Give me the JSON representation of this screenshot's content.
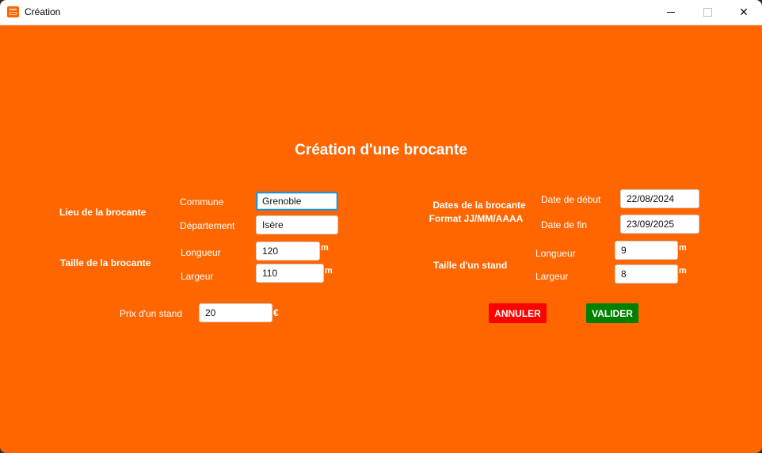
{
  "window": {
    "title": "Création"
  },
  "form": {
    "heading": "Création d'une brocante",
    "lieu": {
      "label": "Lieu de la brocante",
      "commune_label": "Commune",
      "commune_value": "Grenoble",
      "departement_label": "Département",
      "departement_value": "Isère"
    },
    "taille_brocante": {
      "label": "Taille de la brocante",
      "longueur_label": "Longueur",
      "longueur_value": "120",
      "largeur_label": "Largeur",
      "largeur_value": "110",
      "unit": "m"
    },
    "prix": {
      "label": "Prix d'un stand",
      "value": "20",
      "unit": "€"
    },
    "dates": {
      "label_line1": "Dates de la brocante",
      "label_line2": "Format JJ/MM/AAAA",
      "debut_label": "Date de début",
      "debut_value": "22/08/2024",
      "fin_label": "Date de fin",
      "fin_value": "23/09/2025"
    },
    "taille_stand": {
      "label": "Taille d'un stand",
      "longueur_label": "Longueur",
      "longueur_value": "9",
      "largeur_label": "Largeur",
      "largeur_value": "8",
      "unit": "m"
    },
    "buttons": {
      "cancel": "ANNULER",
      "validate": "VALIDER"
    }
  },
  "colors": {
    "background": "#ff6600",
    "cancel": "#ff0000",
    "validate": "#008000",
    "focus": "#2c8fd0"
  },
  "icons": {
    "app": "app-icon",
    "minimize": "minimize-icon",
    "maximize": "maximize-icon",
    "close": "close-icon"
  }
}
